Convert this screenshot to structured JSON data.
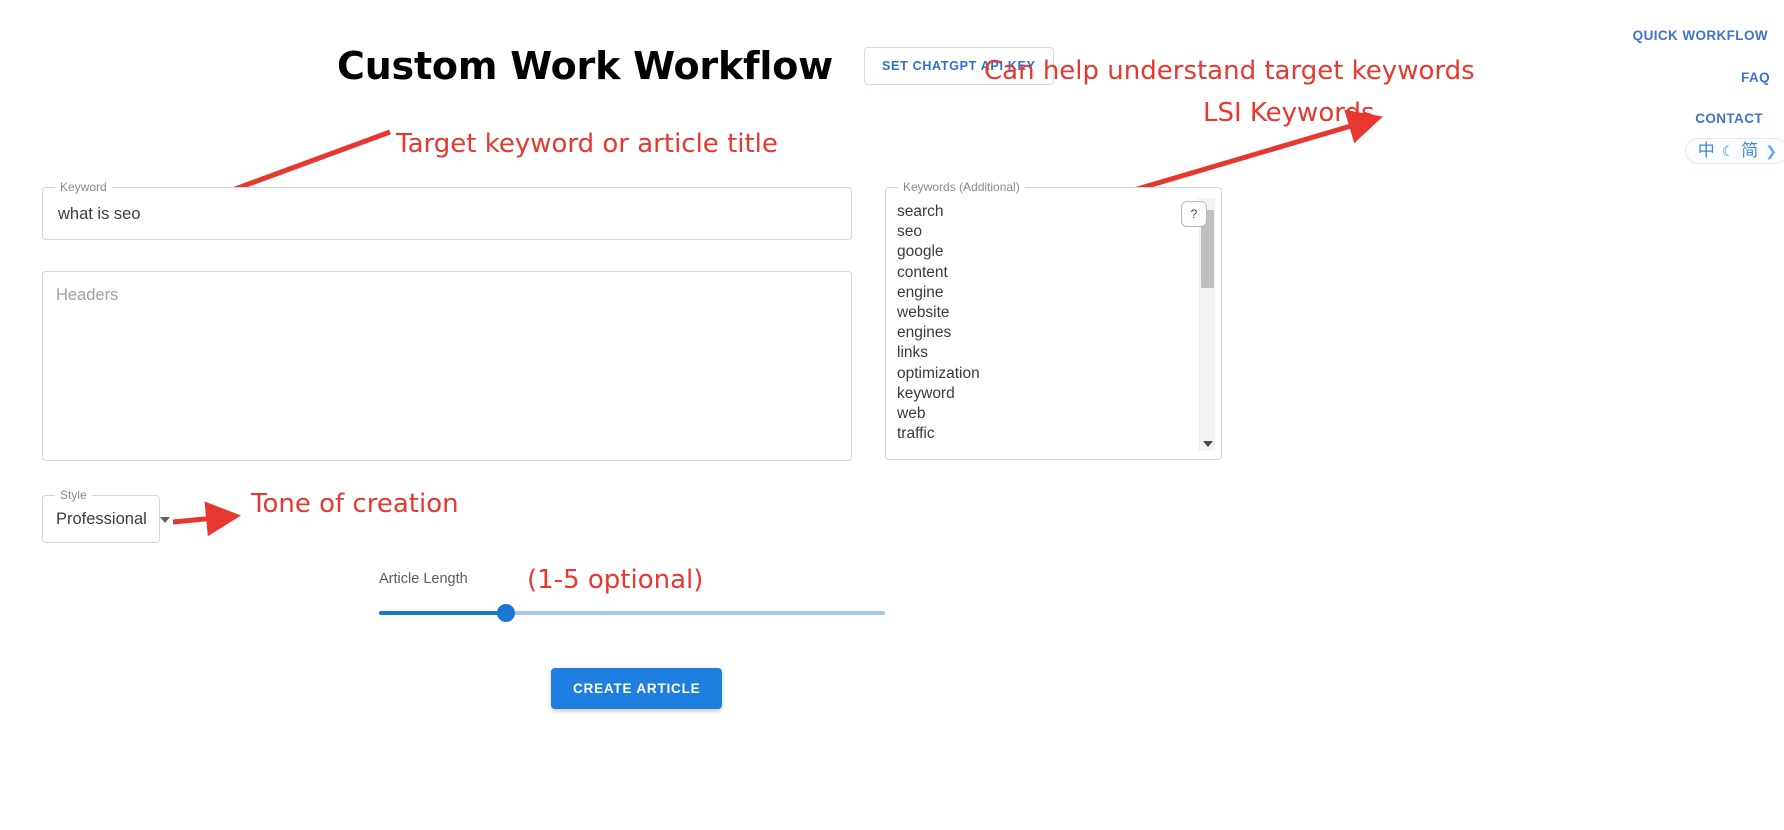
{
  "nav": {
    "quick_workflow": "QUICK WORKFLOW",
    "faq": "FAQ",
    "contact": "CONTACT",
    "lang_zh": "中",
    "lang_moon": "☾",
    "lang_simplified": "简",
    "lang_tail": "❯"
  },
  "header": {
    "title": "Custom Work Workflow",
    "api_key_button": "SET CHATGPT API KEY"
  },
  "annotations": {
    "target_keyword": "Target keyword or article title",
    "lsi_line1": "Can help understand target keywords",
    "lsi_line2": "LSI Keywords",
    "tone": "Tone of creation",
    "length": "(1-5 optional)"
  },
  "form": {
    "keyword": {
      "legend": "Keyword",
      "value": "what is seo"
    },
    "headers": {
      "placeholder": "Headers",
      "value": ""
    },
    "style": {
      "legend": "Style",
      "value": "Professional"
    },
    "keywords_additional": {
      "legend": "Keywords (Additional)",
      "help_label": "?",
      "items": [
        "search",
        "seo",
        "google",
        "content",
        "engine",
        "website",
        "engines",
        "links",
        "optimization",
        "keyword",
        "web",
        "traffic"
      ]
    },
    "article_length": {
      "label": "Article Length",
      "value": 25,
      "min": 0,
      "max": 100
    },
    "submit_button": "CREATE ARTICLE"
  },
  "colors": {
    "accent_blue": "#1e7fe0",
    "nav_blue": "#3f74c9",
    "annotation_red": "#e8372f",
    "slider_track": "#a7c8ea"
  }
}
